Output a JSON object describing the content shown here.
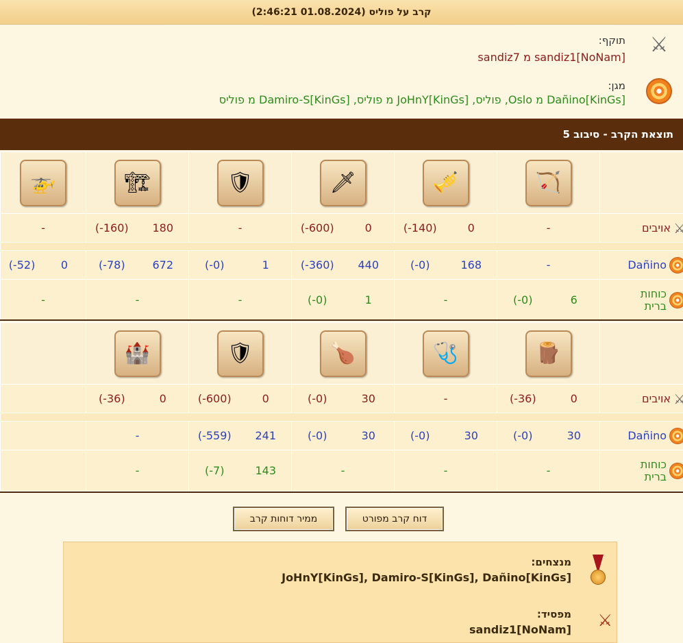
{
  "window": {
    "title": "קרב על פוליס (01.08.2024 2:46:21)"
  },
  "attacker": {
    "label": "תוקף:",
    "text": "sandiz1[NoNam] מ sandiz7",
    "icon": "crossed-swords-icon"
  },
  "defender": {
    "label": "מגן:",
    "text": "Dañino[KinGs] מ Oslo, פוליס, JoHnY[KinGs] מ פוליס, Damiro-S[KinGs] מ פוליס",
    "icon": "shield-icon"
  },
  "result_header": "תוצאת הקרב - סיבוב 5",
  "sections": [
    {
      "units": [
        {
          "icon": "slinger-icon",
          "glyph": "🏹"
        },
        {
          "icon": "trumpeter-icon",
          "glyph": "🎺"
        },
        {
          "icon": "swordsman-icon",
          "glyph": "🗡"
        },
        {
          "icon": "hoplite-icon",
          "glyph": "🛡"
        },
        {
          "icon": "catapult-icon",
          "glyph": "🏗"
        },
        {
          "icon": "gyrocopter-icon",
          "glyph": "🚁"
        }
      ],
      "rows": [
        {
          "kind": "enemy",
          "label": "אויבים",
          "cells": [
            "-",
            [
              "0",
              "(-140)"
            ],
            [
              "0",
              "(-600)"
            ],
            "-",
            [
              "180",
              "(-160)"
            ],
            "-"
          ]
        },
        {
          "kind": "dano",
          "label": "Dañino",
          "cells": [
            "-",
            [
              "168",
              "(-0)"
            ],
            [
              "440",
              "(-360)"
            ],
            [
              "1",
              "(-0)"
            ],
            [
              "672",
              "(-78)"
            ],
            [
              "0",
              "(-52)"
            ]
          ]
        },
        {
          "kind": "ally",
          "label": "כוחות ברית",
          "cells": [
            [
              "6",
              "(-0)"
            ],
            "-",
            [
              "1",
              "(-0)"
            ],
            "-",
            "-",
            "-"
          ]
        }
      ]
    },
    {
      "units": [
        {
          "icon": "ram-icon",
          "glyph": "🪵"
        },
        {
          "icon": "doctor-icon",
          "glyph": "🩺"
        },
        {
          "icon": "cook-icon",
          "glyph": "🍗"
        },
        {
          "icon": "spearman-icon",
          "glyph": "🛡"
        },
        {
          "icon": "ballista-icon",
          "glyph": "🏰"
        }
      ],
      "rows": [
        {
          "kind": "enemy",
          "label": "אויבים",
          "cells": [
            [
              "0",
              "(-36)"
            ],
            "-",
            [
              "30",
              "(-0)"
            ],
            [
              "0",
              "(-600)"
            ],
            [
              "0",
              "(-36)"
            ]
          ]
        },
        {
          "kind": "dano",
          "label": "Dañino",
          "cells": [
            [
              "30",
              "(-0)"
            ],
            [
              "30",
              "(-0)"
            ],
            [
              "30",
              "(-0)"
            ],
            [
              "241",
              "(-559)"
            ],
            "-"
          ]
        },
        {
          "kind": "ally",
          "label": "כוחות ברית",
          "cells": [
            "-",
            "-",
            "-",
            [
              "143",
              "(-7)"
            ],
            "-"
          ]
        }
      ]
    }
  ],
  "buttons": {
    "detailed": "דוח קרב מפורט",
    "converter": "ממיר דוחות קרב"
  },
  "winners": {
    "label": "מנצחים:",
    "text": "JoHnY[KinGs], Damiro-S[KinGs], Dañino[KinGs]"
  },
  "losers": {
    "label": "מפסיד:",
    "text": "sandiz1[NoNam]"
  },
  "colors": {
    "enemy": "#8c1c1c",
    "dano": "#2b3fbf",
    "ally": "#2e8a1c",
    "header_bg": "#5a2d0c"
  }
}
